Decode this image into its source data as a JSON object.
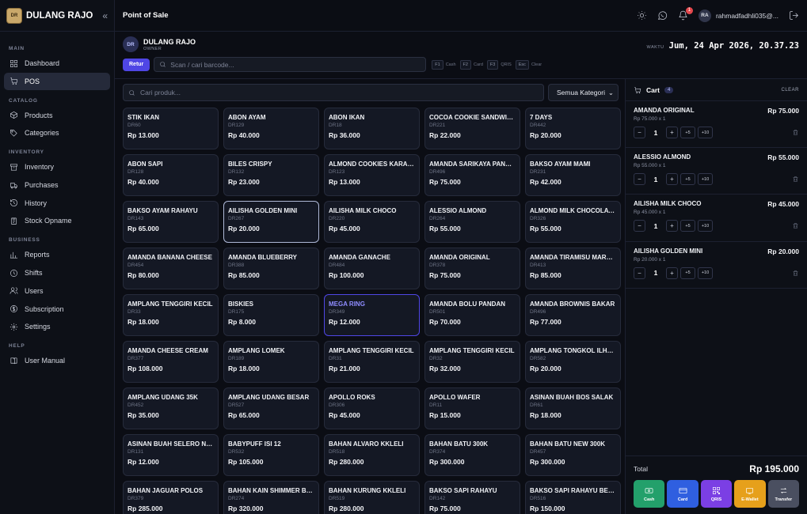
{
  "app": {
    "name": "DULANG RAJO",
    "logo_text": "DULANG RAJO"
  },
  "sidebar": {
    "sections": [
      {
        "title": "MAIN",
        "items": [
          {
            "label": "Dashboard",
            "icon": "grid-icon"
          },
          {
            "label": "POS",
            "icon": "cart-icon",
            "active": true
          }
        ]
      },
      {
        "title": "CATALOG",
        "items": [
          {
            "label": "Products",
            "icon": "box-icon"
          },
          {
            "label": "Categories",
            "icon": "tag-icon"
          }
        ]
      },
      {
        "title": "INVENTORY",
        "items": [
          {
            "label": "Inventory",
            "icon": "archive-icon"
          },
          {
            "label": "Purchases",
            "icon": "truck-icon"
          },
          {
            "label": "History",
            "icon": "history-icon"
          },
          {
            "label": "Stock Opname",
            "icon": "clipboard-icon"
          }
        ]
      },
      {
        "title": "BUSINESS",
        "items": [
          {
            "label": "Reports",
            "icon": "bar-chart-icon"
          },
          {
            "label": "Shifts",
            "icon": "clock-icon"
          },
          {
            "label": "Users",
            "icon": "users-icon"
          },
          {
            "label": "Subscription",
            "icon": "dollar-icon"
          },
          {
            "label": "Settings",
            "icon": "gear-icon"
          }
        ]
      },
      {
        "title": "HELP",
        "items": [
          {
            "label": "User Manual",
            "icon": "book-icon"
          }
        ]
      }
    ]
  },
  "topbar": {
    "title": "Point of Sale",
    "notification_count": "1",
    "user_initials": "RA",
    "user_email": "rahmadfadhli035@..."
  },
  "store": {
    "initials": "DR",
    "name": "DULANG RAJO",
    "role": "OWNER",
    "time_label": "WAKTU",
    "time_value": "Jum, 24 Apr 2026, 20.37.23"
  },
  "scan": {
    "retur_label": "Retur",
    "placeholder": "Scan / cari barcode...",
    "shortcuts": [
      {
        "key": "F1",
        "label": "Cash"
      },
      {
        "key": "F2",
        "label": "Card"
      },
      {
        "key": "F3",
        "label": "QRIS"
      },
      {
        "key": "Esc",
        "label": "Clear"
      }
    ]
  },
  "filters": {
    "search_placeholder": "Cari produk...",
    "category": "Semua Kategori"
  },
  "products": [
    {
      "name": "STIK IKAN",
      "code": "DR60",
      "price": "Rp 13.000"
    },
    {
      "name": "ABON AYAM",
      "code": "DR129",
      "price": "Rp 40.000"
    },
    {
      "name": "ABON IKAN",
      "code": "DR18",
      "price": "Rp 36.000"
    },
    {
      "name": "COCOA COOKIE SANDWICH",
      "code": "DR221",
      "price": "Rp 22.000"
    },
    {
      "name": "7 DAYS",
      "code": "DR442",
      "price": "Rp 20.000"
    },
    {
      "name": "ABON SAPI",
      "code": "DR128",
      "price": "Rp 40.000"
    },
    {
      "name": "BILES CRISPY",
      "code": "DR132",
      "price": "Rp 23.000"
    },
    {
      "name": "ALMOND COOKIES KARAMEL",
      "code": "DR123",
      "price": "Rp 13.000"
    },
    {
      "name": "AMANDA SARIKAYA PANDAN",
      "code": "DR496",
      "price": "Rp 75.000"
    },
    {
      "name": "BAKSO AYAM MAMI",
      "code": "DR231",
      "price": "Rp 42.000"
    },
    {
      "name": "BAKSO AYAM RAHAYU",
      "code": "DR143",
      "price": "Rp 65.000"
    },
    {
      "name": "AILISHA GOLDEN MINI",
      "code": "DR267",
      "price": "Rp 20.000",
      "state": "selected"
    },
    {
      "name": "AILISHA MILK CHOCO",
      "code": "DR220",
      "price": "Rp 45.000"
    },
    {
      "name": "ALESSIO ALMOND",
      "code": "DR264",
      "price": "Rp 55.000"
    },
    {
      "name": "ALMOND MILK CHOCOLATE",
      "code": "DR326",
      "price": "Rp 55.000"
    },
    {
      "name": "AMANDA BANANA CHEESE",
      "code": "DR454",
      "price": "Rp 80.000"
    },
    {
      "name": "AMANDA BLUEBERRY",
      "code": "DR388",
      "price": "Rp 85.000"
    },
    {
      "name": "AMANDA GANACHE",
      "code": "DR484",
      "price": "Rp 100.000"
    },
    {
      "name": "AMANDA ORIGINAL",
      "code": "DR378",
      "price": "Rp 75.000"
    },
    {
      "name": "AMANDA TIRAMISU MARBLE",
      "code": "DR413",
      "price": "Rp 85.000"
    },
    {
      "name": "AMPLANG TENGGIRI KECIL",
      "code": "DR33",
      "price": "Rp 18.000"
    },
    {
      "name": "BISKIES",
      "code": "DR175",
      "price": "Rp 8.000"
    },
    {
      "name": "MEGA RING",
      "code": "DR349",
      "price": "Rp 12.000",
      "state": "highlight"
    },
    {
      "name": "AMANDA BOLU PANDAN",
      "code": "DR501",
      "price": "Rp 70.000"
    },
    {
      "name": "AMANDA BROWNIS BAKAR",
      "code": "DR496",
      "price": "Rp 77.000"
    },
    {
      "name": "AMANDA CHEESE CREAM",
      "code": "DR377",
      "price": "Rp 108.000"
    },
    {
      "name": "AMPLANG LOMEK",
      "code": "DR189",
      "price": "Rp 18.000"
    },
    {
      "name": "AMPLANG TENGGIRI KECIL",
      "code": "DR31",
      "price": "Rp 21.000"
    },
    {
      "name": "AMPLANG TENGGIRI KECIL",
      "code": "DR32",
      "price": "Rp 32.000"
    },
    {
      "name": "AMPLANG TONGKOL ILHAM",
      "code": "DR582",
      "price": "Rp 20.000"
    },
    {
      "name": "AMPLANG UDANG 35K",
      "code": "DR452",
      "price": "Rp 35.000"
    },
    {
      "name": "AMPLANG UDANG BESAR",
      "code": "DR527",
      "price": "Rp 65.000"
    },
    {
      "name": "APOLLO ROKS",
      "code": "DR306",
      "price": "Rp 45.000"
    },
    {
      "name": "APOLLO WAFER",
      "code": "DR11",
      "price": "Rp 15.000"
    },
    {
      "name": "ASINAN BUAH BOS SALAK",
      "code": "DR61",
      "price": "Rp 18.000"
    },
    {
      "name": "ASINAN BUAH SELERO NUSANTARA",
      "code": "DR131",
      "price": "Rp 12.000"
    },
    {
      "name": "BABYPUFF ISI 12",
      "code": "DR532",
      "price": "Rp 105.000"
    },
    {
      "name": "BAHAN ALVARO KKLELI",
      "code": "DR518",
      "price": "Rp 280.000"
    },
    {
      "name": "BAHAN BATU 300K",
      "code": "DR374",
      "price": "Rp 300.000"
    },
    {
      "name": "BAHAN BATU NEW 300K",
      "code": "DR457",
      "price": "Rp 300.000"
    },
    {
      "name": "BAHAN JAGUAR POLOS",
      "code": "DR379",
      "price": "Rp 285.000"
    },
    {
      "name": "BAHAN KAIN SHIMMER BORDIR",
      "code": "DR274",
      "price": "Rp 320.000"
    },
    {
      "name": "BAHAN KURUNG KKLELI",
      "code": "DR519",
      "price": "Rp 280.000"
    },
    {
      "name": "BAKSO SAPI RAHAYU",
      "code": "DR142",
      "price": "Rp 75.000"
    },
    {
      "name": "BAKSO SAPI RAHAYU BESAR",
      "code": "DR516",
      "price": "Rp 150.000"
    }
  ],
  "cart": {
    "title": "Cart",
    "count": "4",
    "clear_label": "CLEAR",
    "items": [
      {
        "name": "AMANDA ORIGINAL",
        "unit": "Rp 75.000 x 1",
        "qty": "1",
        "total": "Rp 75.000"
      },
      {
        "name": "ALESSIO ALMOND",
        "unit": "Rp 55.000 x 1",
        "qty": "1",
        "total": "Rp 55.000"
      },
      {
        "name": "AILISHA MILK CHOCO",
        "unit": "Rp 45.000 x 1",
        "qty": "1",
        "total": "Rp 45.000"
      },
      {
        "name": "AILISHA GOLDEN MINI",
        "unit": "Rp 20.000 x 1",
        "qty": "1",
        "total": "Rp 20.000"
      }
    ],
    "controls": {
      "minus": "−",
      "plus": "+",
      "plus5": "+5",
      "plus10": "+10"
    },
    "total_label": "Total",
    "total_value": "Rp 195.000",
    "payments": [
      {
        "label": "Cash",
        "key": "cash"
      },
      {
        "label": "Card",
        "key": "card"
      },
      {
        "label": "QRIS",
        "key": "qris"
      },
      {
        "label": "E-Wallet",
        "key": "ewallet"
      },
      {
        "label": "Transfer",
        "key": "transfer"
      }
    ]
  },
  "colors": {
    "accent": "#4f46e5",
    "cash": "#23a06b",
    "card": "#2f5fe0",
    "qris": "#7b3fe4",
    "ewallet": "#e6a01b",
    "transfer": "#4a4f60"
  }
}
